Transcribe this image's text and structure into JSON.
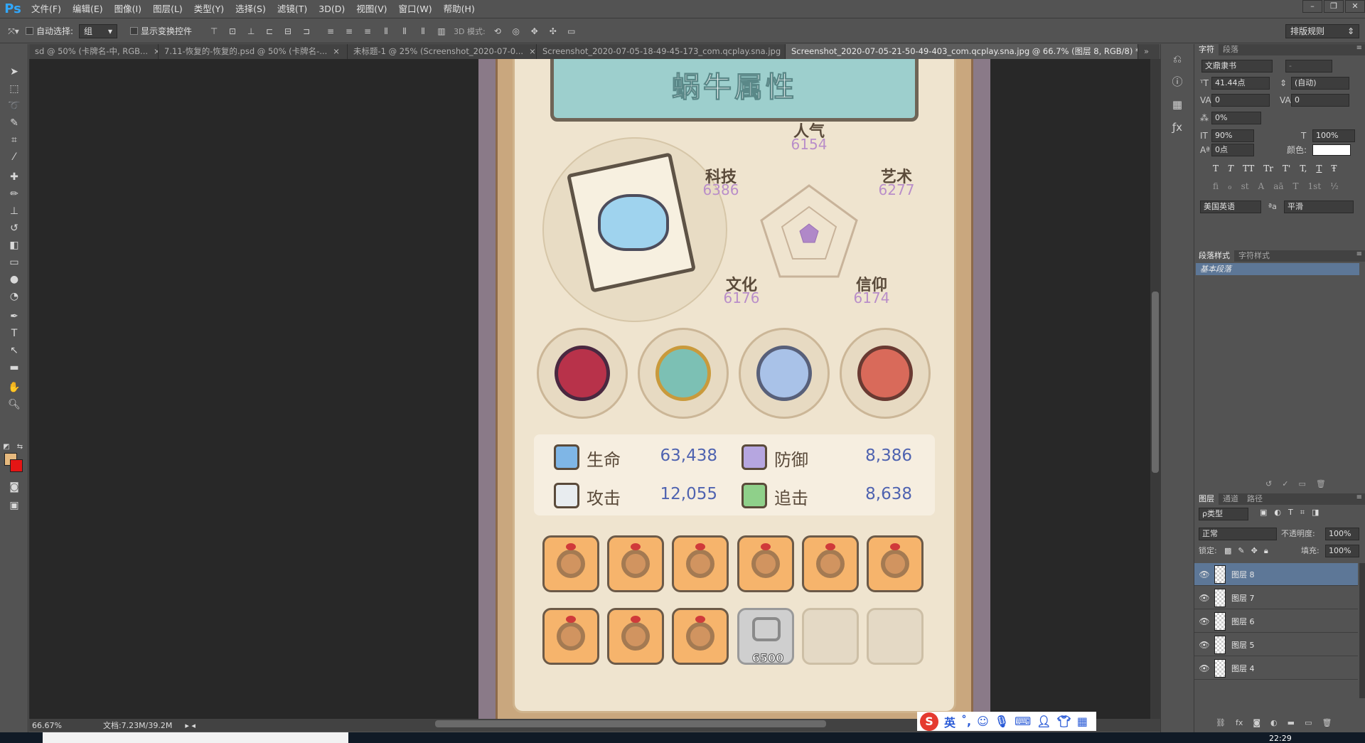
{
  "app": {
    "logo": "Ps"
  },
  "menu": [
    "文件(F)",
    "编辑(E)",
    "图像(I)",
    "图层(L)",
    "类型(Y)",
    "选择(S)",
    "滤镜(T)",
    "3D(D)",
    "视图(V)",
    "窗口(W)",
    "帮助(H)"
  ],
  "window_controls": [
    "–",
    "❐",
    "✕"
  ],
  "options": {
    "auto_select_label": "自动选择:",
    "auto_select_value": "组",
    "show_transform_label": "显示变换控件",
    "mode3d_label": "3D 模式:",
    "workspace": "排版规则"
  },
  "tabs": [
    {
      "label": "sd @ 50% (卡牌名-中, RGB...",
      "active": false
    },
    {
      "label": "7.11-恢复的-恢复的.psd @ 50% (卡牌名-...",
      "active": false
    },
    {
      "label": "未标题-1 @ 25% (Screenshot_2020-07-0...",
      "active": false
    },
    {
      "label": "Screenshot_2020-07-05-18-49-45-173_com.qcplay.sna.jpg",
      "active": false
    },
    {
      "label": "Screenshot_2020-07-05-21-50-49-403_com.qcplay.sna.jpg @ 66.7% (图层 8, RGB/8) *",
      "active": true
    }
  ],
  "tab_close": "×",
  "tab_overflow": "»",
  "status": {
    "zoom": "66.67%",
    "doc": "文档:7.23M/39.2M"
  },
  "game": {
    "title": "蜗牛属性",
    "radar_stats": [
      {
        "name": "人气",
        "value": "6154"
      },
      {
        "name": "科技",
        "value": "6386"
      },
      {
        "name": "艺术",
        "value": "6277"
      },
      {
        "name": "文化",
        "value": "6176"
      },
      {
        "name": "信仰",
        "value": "6174"
      }
    ],
    "attributes": [
      {
        "name": "生命",
        "value": "63,438",
        "color": "#7fb6e6"
      },
      {
        "name": "防御",
        "value": "8,386",
        "color": "#b6a6e0"
      },
      {
        "name": "攻击",
        "value": "12,055",
        "color": "#e8ecef"
      },
      {
        "name": "追击",
        "value": "8,638",
        "color": "#8fd08a"
      }
    ],
    "slot_cost": "6500"
  },
  "character_panel": {
    "tabs": [
      "字符",
      "段落"
    ],
    "font_family": "文鼎隶书",
    "font_style": "-",
    "font_size": "41.44点",
    "leading": "(自动)",
    "kerning": "0",
    "tracking": "0",
    "tsume": "0%",
    "vscale": "90%",
    "hscale": "100%",
    "baseline": "0点",
    "color_label": "颜色:",
    "style_buttons": [
      "T",
      "T",
      "TT",
      "Tr",
      "T'",
      "T,",
      "T",
      "Ŧ"
    ],
    "ot_buttons": [
      "fi",
      "ℴ",
      "st",
      "A",
      "aā",
      "T",
      "1st",
      "½"
    ],
    "language": "美国英语",
    "aa_label": "ªa",
    "aa": "平滑"
  },
  "para_style_panel": {
    "tabs": [
      "段落样式",
      "字符样式"
    ],
    "selected": "基本段落"
  },
  "layers_panel": {
    "tabs": [
      "图层",
      "通道",
      "路径"
    ],
    "filter": "ρ类型",
    "blend_mode": "正常",
    "opacity_label": "不透明度:",
    "opacity": "100%",
    "lock_label": "锁定:",
    "fill_label": "填充:",
    "fill": "100%",
    "layers": [
      {
        "name": "图层 8",
        "active": true
      },
      {
        "name": "图层 7",
        "active": false
      },
      {
        "name": "图层 6",
        "active": false
      },
      {
        "name": "图层 5",
        "active": false
      },
      {
        "name": "图层 4",
        "active": false
      }
    ]
  },
  "ime": {
    "logo": "S",
    "lang": "英"
  },
  "clock": "22:29"
}
